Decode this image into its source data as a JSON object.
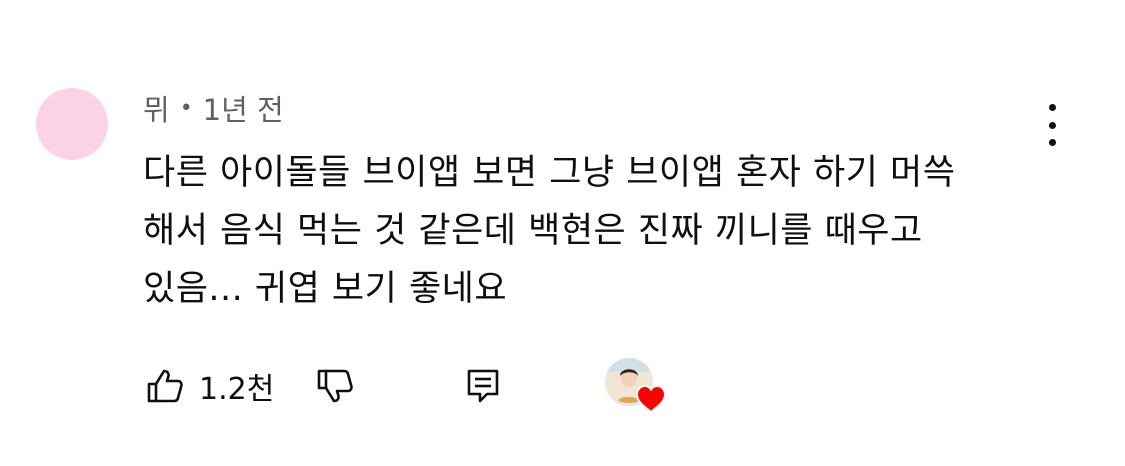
{
  "comment": {
    "author": "뮈",
    "separator": "•",
    "time": "1년 전",
    "text_lines": [
      "다른 아이돌들 브이앱 보면 그냥 브이앱 혼자 하기 머쓱",
      "해서 음식 먹는 것 같은데 백현은 진짜 끼니를 때우고",
      "있음... 귀엽 보기 좋네요"
    ],
    "like_count": "1.2천",
    "heart_color": "#ff0000",
    "avatar_color": "#fcd3e6"
  },
  "icons": {
    "more": "more-vertical-icon",
    "like": "thumbs-up-icon",
    "dislike": "thumbs-down-icon",
    "reply": "comment-icon",
    "heart": "heart-icon"
  }
}
